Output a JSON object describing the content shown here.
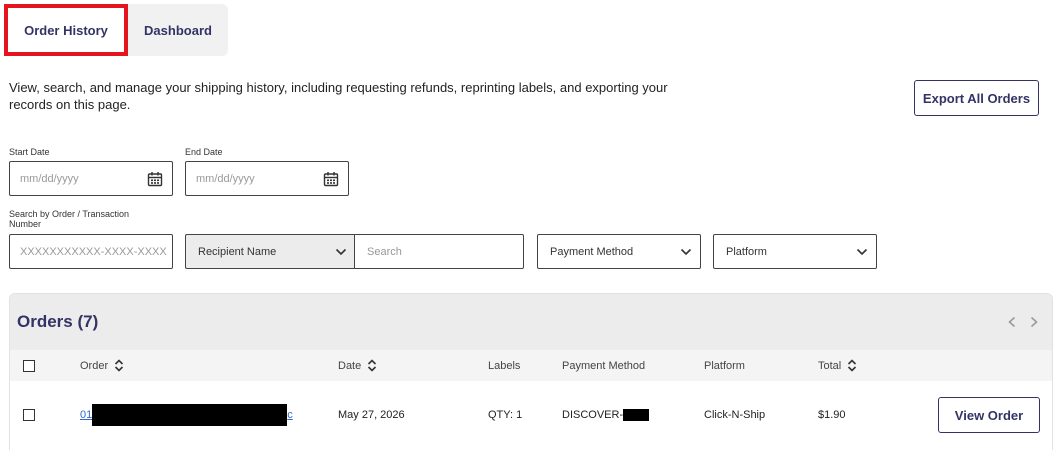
{
  "tabs": [
    {
      "label": "Order History",
      "active": true
    },
    {
      "label": "Dashboard",
      "active": false
    }
  ],
  "intro": "View, search, and manage your shipping history, including requesting refunds, reprinting labels, and exporting your records on this page.",
  "export_label": "Export All Orders",
  "filters": {
    "start_date": {
      "label": "Start Date",
      "placeholder": "mm/dd/yyyy"
    },
    "end_date": {
      "label": "End Date",
      "placeholder": "mm/dd/yyyy"
    },
    "order_search": {
      "label": "Search by Order / Transaction Number",
      "placeholder": "XXXXXXXXXXX-XXXX-XXXX"
    },
    "recipient_select": "Recipient Name",
    "search_placeholder": "Search",
    "payment_select": "Payment Method",
    "platform_select": "Platform"
  },
  "orders": {
    "title": "Orders (7)",
    "columns": {
      "order": "Order",
      "date": "Date",
      "labels": "Labels",
      "payment": "Payment Method",
      "platform": "Platform",
      "total": "Total"
    },
    "rows": [
      {
        "order_prefix": "01",
        "order_suffix": "c",
        "date": "May 27, 2026",
        "labels": "QTY: 1",
        "payment": "DISCOVER-",
        "platform": "Click-N-Ship",
        "total": "$1.90",
        "action": "View Order"
      }
    ]
  },
  "colors": {
    "brand": "#333366",
    "active_tab_border": "#e4151f",
    "link": "#3366cc"
  }
}
